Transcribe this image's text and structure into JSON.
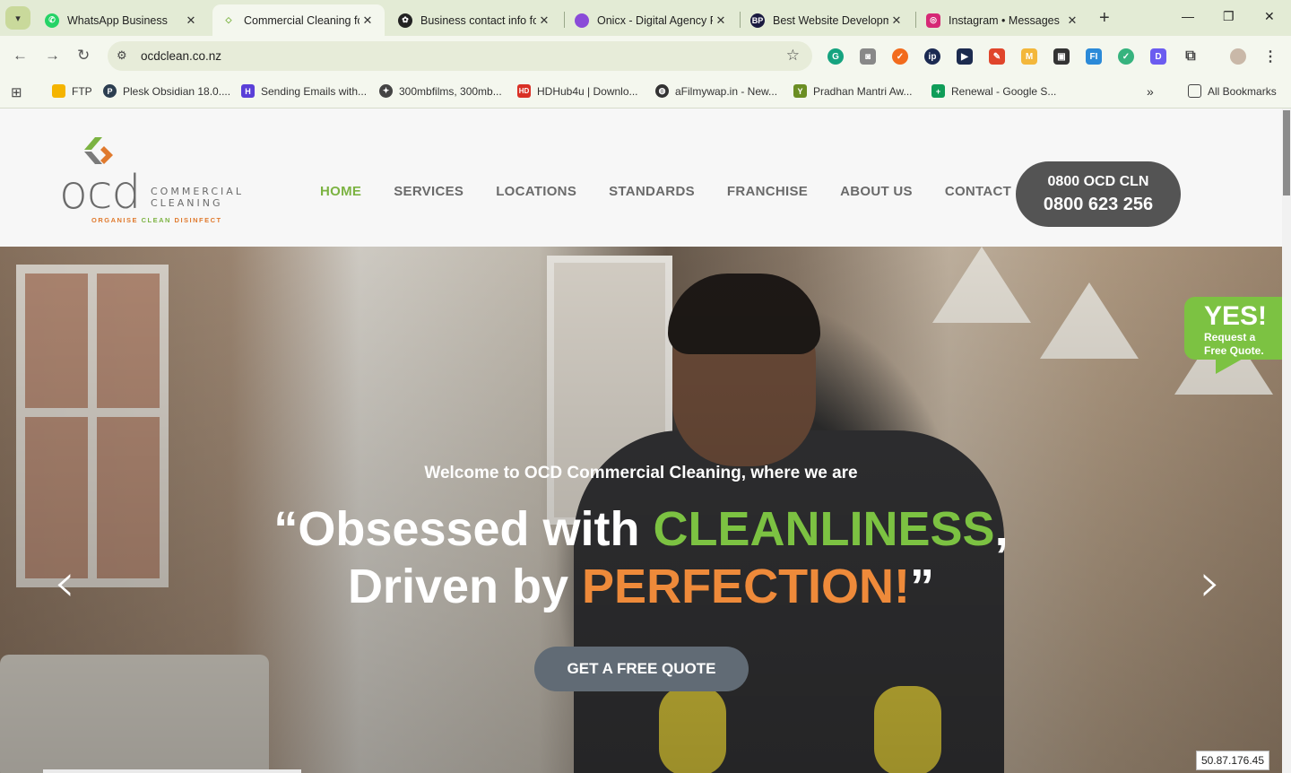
{
  "browser": {
    "tabs": [
      {
        "title": "WhatsApp Business",
        "color": "#25d366",
        "icon": "whatsapp-icon",
        "active": false
      },
      {
        "title": "Commercial Cleaning fo",
        "color": "#7cb342",
        "icon": "ocd-favicon-icon",
        "active": true
      },
      {
        "title": "Business contact info fo",
        "color": "#222222",
        "icon": "openai-icon",
        "active": false
      },
      {
        "title": "Onicx - Digital Agency F",
        "color": "#8a4bd8",
        "icon": "onicx-icon",
        "active": false
      },
      {
        "title": "Best Website Developm",
        "color": "#1a1a40",
        "icon": "bp-icon",
        "active": false
      },
      {
        "title": "Instagram • Messages",
        "color": "#d62976",
        "icon": "instagram-icon",
        "active": false
      }
    ],
    "url": "ocdclean.co.nz",
    "bookmarks": [
      {
        "label": "FTP",
        "color": "#f4b400",
        "icon": "folder-icon"
      },
      {
        "label": "Plesk Obsidian 18.0....",
        "color": "#2c3e50",
        "icon": "plesk-icon"
      },
      {
        "label": "Sending Emails with...",
        "color": "#5a3fd8",
        "icon": "hostinger-icon"
      },
      {
        "label": "300mbfilms, 300mb...",
        "color": "#444444",
        "icon": "film-icon"
      },
      {
        "label": "HDHub4u | Downlo...",
        "color": "#d93025",
        "icon": "hd-icon"
      },
      {
        "label": "aFilmywap.in - New...",
        "color": "#333333",
        "icon": "globe-icon"
      },
      {
        "label": "Pradhan Mantri Aw...",
        "color": "#6b8e23",
        "icon": "emblem-icon"
      },
      {
        "label": "Renewal - Google S...",
        "color": "#0f9d58",
        "icon": "sheets-icon"
      }
    ],
    "all_bookmarks": "All Bookmarks"
  },
  "site": {
    "logo": {
      "word": "ocd",
      "commercial": "COMMERCIAL",
      "cleaning": "CLEANING",
      "tagline_organise": "ORGANISE",
      "tagline_clean": "CLEAN",
      "tagline_disinfect": "DISINFECT"
    },
    "nav": [
      "HOME",
      "SERVICES",
      "LOCATIONS",
      "STANDARDS",
      "FRANCHISE",
      "ABOUT US",
      "CONTACT"
    ],
    "active_nav": "HOME",
    "phone_words": "0800 OCD CLN",
    "phone_number": "0800 623 256"
  },
  "hero": {
    "subtitle": "Welcome to OCD Commercial Cleaning, where we are",
    "line1_prefix": "“Obsessed with ",
    "line1_highlight": "CLEANLINESS",
    "line1_suffix": ",",
    "line2_prefix": "Driven by ",
    "line2_highlight": "PERFECTION!",
    "line2_suffix": "”",
    "cta": "GET A FREE QUOTE"
  },
  "quote_badge": {
    "yes": "YES!",
    "line1": "Request a",
    "line2": "Free Quote."
  },
  "ip_address": "50.87.176.45",
  "colors": {
    "brand_green": "#7cb342",
    "brand_orange": "#ee8a3a",
    "pill_gray": "#545454"
  }
}
